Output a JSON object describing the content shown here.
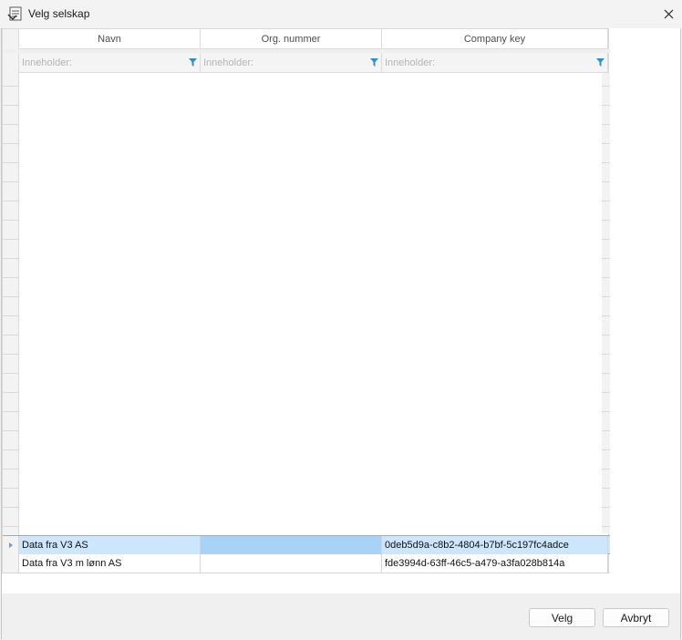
{
  "window": {
    "title": "Velg selskap",
    "close_glyph": "✕"
  },
  "grid": {
    "columns": [
      {
        "key": "navn",
        "label": "Navn"
      },
      {
        "key": "org",
        "label": "Org. nummer"
      },
      {
        "key": "company_key",
        "label": "Company key"
      }
    ],
    "filter_placeholder": "Inneholder:",
    "rows": [
      {
        "navn": "Data fra V3 AS",
        "org": "",
        "company_key": "0deb5d9a-c8b2-4804-b7bf-5c197fc4adce",
        "selected": true
      },
      {
        "navn": "Data fra V3 m lønn AS",
        "org": "",
        "company_key": "fde3994d-63ff-46c5-a479-a3fa028b814a",
        "selected": false
      }
    ]
  },
  "buttons": {
    "select_label": "Velg",
    "cancel_label": "Avbryt"
  },
  "colors": {
    "selection": "#cce6fb",
    "focused_cell": "#a9d2f7",
    "filter_icon": "#2a8fd0"
  }
}
